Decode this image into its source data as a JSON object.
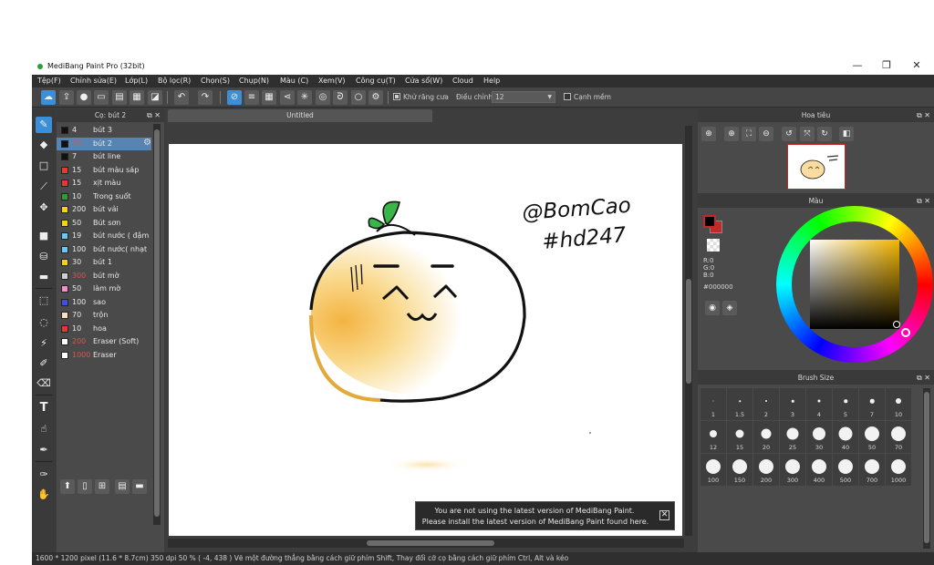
{
  "window": {
    "title": "MediBang Paint Pro (32bit)",
    "minimize_glyph": "—",
    "maximize_glyph": "❐",
    "close_glyph": "✕"
  },
  "menu": [
    "Tệp(F)",
    "Chỉnh sửa(E)",
    "Lớp(L)",
    "Bộ lọc(R)",
    "Chọn(S)",
    "Chụp(N)",
    "Màu (C)",
    "Xem(V)",
    "Công cụ(T)",
    "Cửa sổ(W)",
    "Cloud",
    "Help"
  ],
  "toolbar": {
    "antialias_label": "Khử răng cưa",
    "correction_label": "Điều chỉnh",
    "correction_value": "12",
    "edge_label": "Cạnh mềm",
    "antialias_checked": true,
    "edge_checked": false
  },
  "brush_panel": {
    "title": "Cọ: bút 2",
    "brushes": [
      {
        "size": "4",
        "name": "bút 3",
        "color": "#111111",
        "selected": false,
        "size_red": false
      },
      {
        "size": "10",
        "name": "bút 2",
        "color": "#111111",
        "selected": true,
        "size_red": true
      },
      {
        "size": "7",
        "name": "bút line",
        "color": "#111111",
        "selected": false,
        "size_red": false
      },
      {
        "size": "15",
        "name": "bút màu sáp",
        "color": "#e53935",
        "selected": false,
        "size_red": false
      },
      {
        "size": "15",
        "name": "xịt màu",
        "color": "#e53935",
        "selected": false,
        "size_red": false
      },
      {
        "size": "10",
        "name": "Trong suốt",
        "color": "#2e9c3a",
        "selected": false,
        "size_red": false
      },
      {
        "size": "200",
        "name": "bút vải",
        "color": "#f2d21b",
        "selected": false,
        "size_red": false
      },
      {
        "size": "50",
        "name": "Bút sơn",
        "color": "#f2d21b",
        "selected": false,
        "size_red": false
      },
      {
        "size": "19",
        "name": "bút nước ( đậm",
        "color": "#6ec6f0",
        "selected": false,
        "size_red": false
      },
      {
        "size": "100",
        "name": "bút nước( nhạt",
        "color": "#6ec6f0",
        "selected": false,
        "size_red": false
      },
      {
        "size": "30",
        "name": "bút 1",
        "color": "#f2d21b",
        "selected": false,
        "size_red": false
      },
      {
        "size": "300",
        "name": "bút mờ",
        "color": "#cfcfcf",
        "selected": false,
        "size_red": true
      },
      {
        "size": "50",
        "name": "làm mờ",
        "color": "#f48fc8",
        "selected": false,
        "size_red": false
      },
      {
        "size": "100",
        "name": "sao",
        "color": "#3f51d8",
        "selected": false,
        "size_red": false
      },
      {
        "size": "70",
        "name": "trộn",
        "color": "#f4e0c8",
        "selected": false,
        "size_red": false
      },
      {
        "size": "10",
        "name": "hoa",
        "color": "#e53935",
        "selected": false,
        "size_red": false
      },
      {
        "size": "200",
        "name": "Eraser (Soft)",
        "color": "#ffffff",
        "selected": false,
        "size_red": true
      },
      {
        "size": "1000",
        "name": "Eraser",
        "color": "#ffffff",
        "selected": false,
        "size_red": true
      }
    ]
  },
  "document": {
    "tab_title": "Untitled",
    "drawing_text_1": "@BomCao",
    "drawing_text_2": "#hd247"
  },
  "notice": {
    "line1": "You are not using the latest version of MediBang Paint.",
    "line2": "Please install the latest version of MediBang Paint found here."
  },
  "navigator": {
    "title": "Hoa tiêu"
  },
  "color_panel": {
    "title": "Màu",
    "r": "R:0",
    "g": "G:0",
    "b": "B:0",
    "hex": "#000000",
    "foreground": "#000000",
    "background": "#c62828"
  },
  "brush_size_panel": {
    "title": "Brush Size",
    "sizes": [
      "1",
      "1.5",
      "2",
      "3",
      "4",
      "5",
      "7",
      "10",
      "12",
      "15",
      "20",
      "25",
      "30",
      "40",
      "50",
      "70",
      "100",
      "150",
      "200",
      "300",
      "400",
      "500",
      "700",
      "1000"
    ]
  },
  "statusbar": {
    "text": "1600 * 1200 pixel  (11.6 * 8.7cm)  350 dpi  50 %  ( -4, 438 )  Vẽ một đường thẳng bằng cách giữ phím Shift, Thay đổi cỡ cọ bằng cách giữ phím Ctrl, Alt và kéo"
  },
  "colors": {
    "accent": "#3b8fd8",
    "selected_row": "#5884b4",
    "panel_bg": "#4a4a4a"
  },
  "icons": {
    "toolbar": [
      "cloud-icon",
      "share-icon",
      "comment-icon",
      "chat-icon",
      "document-icon",
      "grid-icon",
      "layout-icon",
      "undo-icon",
      "redo-icon",
      "no-pattern-icon",
      "hatch-icon",
      "grid-pattern-icon",
      "radial-icon",
      "burst-icon",
      "concentric-icon",
      "curve-icon",
      "circle-icon",
      "gear-icon"
    ],
    "tools": [
      "brush-icon",
      "eraser-icon",
      "rectangle-icon",
      "dot-line-icon",
      "move-icon",
      "fill-rect-icon",
      "bucket-icon",
      "gradient-icon",
      "select-rect-icon",
      "lasso-icon",
      "magic-wand-icon",
      "select-pen-icon",
      "select-eraser-icon",
      "text-icon",
      "operation-icon",
      "divide-icon",
      "eyedropper-icon",
      "hand-icon"
    ]
  }
}
